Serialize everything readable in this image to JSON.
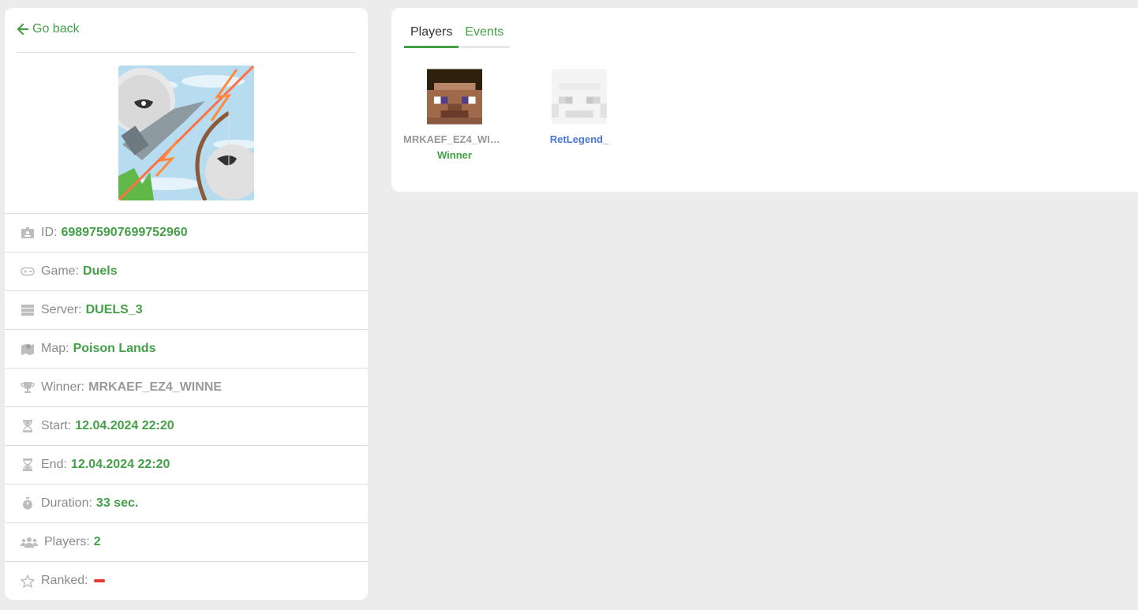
{
  "nav": {
    "back_label": "Go back"
  },
  "match_image": {
    "alt": "Duels game image"
  },
  "info": [
    {
      "key": "id",
      "icon": "id-card-icon",
      "label": "ID:",
      "value": "698975907699752960"
    },
    {
      "key": "game",
      "icon": "gamepad-icon",
      "label": "Game:",
      "value": "Duels"
    },
    {
      "key": "server",
      "icon": "server-icon",
      "label": "Server:",
      "value": "DUELS_3"
    },
    {
      "key": "map",
      "icon": "map-icon",
      "label": "Map:",
      "value": "Poison Lands"
    },
    {
      "key": "winner",
      "icon": "trophy-icon",
      "label": "Winner:",
      "value": "MRKAEF_EZ4_WINNE"
    },
    {
      "key": "start",
      "icon": "hourglass-start-icon",
      "label": "Start:",
      "value": "12.04.2024 22:20"
    },
    {
      "key": "end",
      "icon": "hourglass-end-icon",
      "label": "End:",
      "value": "12.04.2024 22:20"
    },
    {
      "key": "duration",
      "icon": "stopwatch-icon",
      "label": "Duration:",
      "value": "33 sec."
    },
    {
      "key": "players",
      "icon": "users-icon",
      "label": "Players:",
      "value": "2"
    },
    {
      "key": "ranked",
      "icon": "star-icon",
      "label": "Ranked:",
      "value": ""
    }
  ],
  "tabs": [
    {
      "label": "Players",
      "active": true
    },
    {
      "label": "Events",
      "active": false
    }
  ],
  "players": [
    {
      "name": "MRKAEF_EZ4_WIN…",
      "status": "Winner"
    },
    {
      "name": "RetLegend_",
      "status": ""
    }
  ],
  "colors": {
    "accent": "#43a047",
    "link_blue": "#4a76d6",
    "ranked_no": "#e53935"
  }
}
